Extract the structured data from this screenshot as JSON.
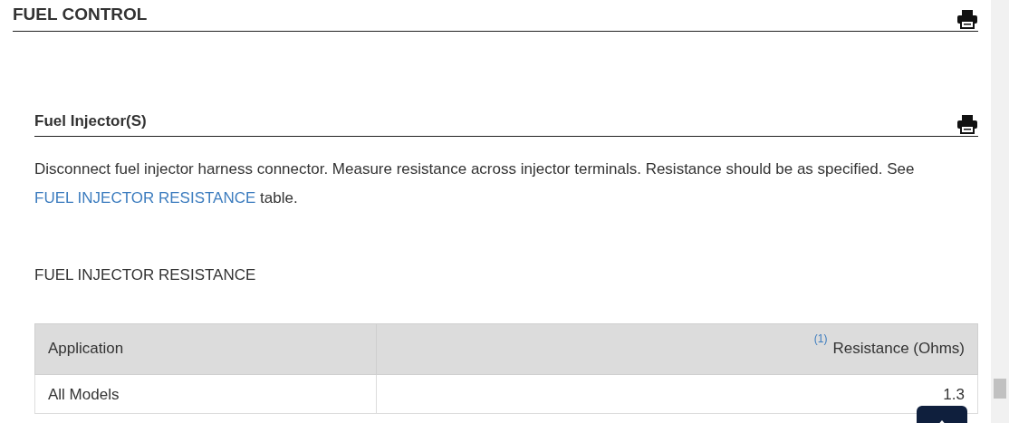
{
  "page_title": "FUEL CONTROL",
  "section": {
    "title": "Fuel Injector(S)",
    "paragraph": {
      "before": "Disconnect fuel injector harness connector. Measure resistance across injector terminals. Resistance should be as specified. See",
      "link": "FUEL INJECTOR RESISTANCE",
      "after": "table."
    },
    "table_caption": "FUEL INJECTOR RESISTANCE",
    "table": {
      "columns": [
        {
          "label": "Application"
        },
        {
          "label": "Resistance (Ohms)",
          "footnote": "(1)"
        }
      ],
      "rows": [
        [
          "All Models",
          "1.3"
        ]
      ]
    }
  }
}
